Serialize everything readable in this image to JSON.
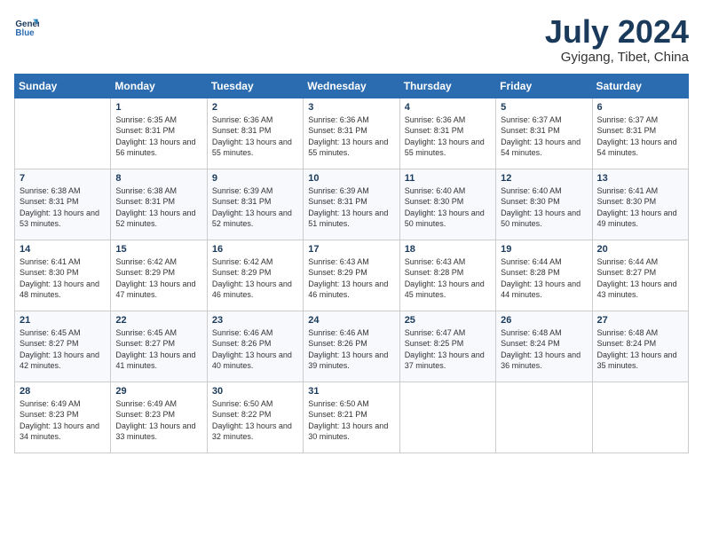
{
  "header": {
    "logo_line1": "General",
    "logo_line2": "Blue",
    "month_title": "July 2024",
    "location": "Gyigang, Tibet, China"
  },
  "weekdays": [
    "Sunday",
    "Monday",
    "Tuesday",
    "Wednesday",
    "Thursday",
    "Friday",
    "Saturday"
  ],
  "weeks": [
    [
      {
        "day": "",
        "sunrise": "",
        "sunset": "",
        "daylight": ""
      },
      {
        "day": "1",
        "sunrise": "6:35 AM",
        "sunset": "8:31 PM",
        "daylight": "13 hours and 56 minutes."
      },
      {
        "day": "2",
        "sunrise": "6:36 AM",
        "sunset": "8:31 PM",
        "daylight": "13 hours and 55 minutes."
      },
      {
        "day": "3",
        "sunrise": "6:36 AM",
        "sunset": "8:31 PM",
        "daylight": "13 hours and 55 minutes."
      },
      {
        "day": "4",
        "sunrise": "6:36 AM",
        "sunset": "8:31 PM",
        "daylight": "13 hours and 55 minutes."
      },
      {
        "day": "5",
        "sunrise": "6:37 AM",
        "sunset": "8:31 PM",
        "daylight": "13 hours and 54 minutes."
      },
      {
        "day": "6",
        "sunrise": "6:37 AM",
        "sunset": "8:31 PM",
        "daylight": "13 hours and 54 minutes."
      }
    ],
    [
      {
        "day": "7",
        "sunrise": "6:38 AM",
        "sunset": "8:31 PM",
        "daylight": "13 hours and 53 minutes."
      },
      {
        "day": "8",
        "sunrise": "6:38 AM",
        "sunset": "8:31 PM",
        "daylight": "13 hours and 52 minutes."
      },
      {
        "day": "9",
        "sunrise": "6:39 AM",
        "sunset": "8:31 PM",
        "daylight": "13 hours and 52 minutes."
      },
      {
        "day": "10",
        "sunrise": "6:39 AM",
        "sunset": "8:31 PM",
        "daylight": "13 hours and 51 minutes."
      },
      {
        "day": "11",
        "sunrise": "6:40 AM",
        "sunset": "8:30 PM",
        "daylight": "13 hours and 50 minutes."
      },
      {
        "day": "12",
        "sunrise": "6:40 AM",
        "sunset": "8:30 PM",
        "daylight": "13 hours and 50 minutes."
      },
      {
        "day": "13",
        "sunrise": "6:41 AM",
        "sunset": "8:30 PM",
        "daylight": "13 hours and 49 minutes."
      }
    ],
    [
      {
        "day": "14",
        "sunrise": "6:41 AM",
        "sunset": "8:30 PM",
        "daylight": "13 hours and 48 minutes."
      },
      {
        "day": "15",
        "sunrise": "6:42 AM",
        "sunset": "8:29 PM",
        "daylight": "13 hours and 47 minutes."
      },
      {
        "day": "16",
        "sunrise": "6:42 AM",
        "sunset": "8:29 PM",
        "daylight": "13 hours and 46 minutes."
      },
      {
        "day": "17",
        "sunrise": "6:43 AM",
        "sunset": "8:29 PM",
        "daylight": "13 hours and 46 minutes."
      },
      {
        "day": "18",
        "sunrise": "6:43 AM",
        "sunset": "8:28 PM",
        "daylight": "13 hours and 45 minutes."
      },
      {
        "day": "19",
        "sunrise": "6:44 AM",
        "sunset": "8:28 PM",
        "daylight": "13 hours and 44 minutes."
      },
      {
        "day": "20",
        "sunrise": "6:44 AM",
        "sunset": "8:27 PM",
        "daylight": "13 hours and 43 minutes."
      }
    ],
    [
      {
        "day": "21",
        "sunrise": "6:45 AM",
        "sunset": "8:27 PM",
        "daylight": "13 hours and 42 minutes."
      },
      {
        "day": "22",
        "sunrise": "6:45 AM",
        "sunset": "8:27 PM",
        "daylight": "13 hours and 41 minutes."
      },
      {
        "day": "23",
        "sunrise": "6:46 AM",
        "sunset": "8:26 PM",
        "daylight": "13 hours and 40 minutes."
      },
      {
        "day": "24",
        "sunrise": "6:46 AM",
        "sunset": "8:26 PM",
        "daylight": "13 hours and 39 minutes."
      },
      {
        "day": "25",
        "sunrise": "6:47 AM",
        "sunset": "8:25 PM",
        "daylight": "13 hours and 37 minutes."
      },
      {
        "day": "26",
        "sunrise": "6:48 AM",
        "sunset": "8:24 PM",
        "daylight": "13 hours and 36 minutes."
      },
      {
        "day": "27",
        "sunrise": "6:48 AM",
        "sunset": "8:24 PM",
        "daylight": "13 hours and 35 minutes."
      }
    ],
    [
      {
        "day": "28",
        "sunrise": "6:49 AM",
        "sunset": "8:23 PM",
        "daylight": "13 hours and 34 minutes."
      },
      {
        "day": "29",
        "sunrise": "6:49 AM",
        "sunset": "8:23 PM",
        "daylight": "13 hours and 33 minutes."
      },
      {
        "day": "30",
        "sunrise": "6:50 AM",
        "sunset": "8:22 PM",
        "daylight": "13 hours and 32 minutes."
      },
      {
        "day": "31",
        "sunrise": "6:50 AM",
        "sunset": "8:21 PM",
        "daylight": "13 hours and 30 minutes."
      },
      {
        "day": "",
        "sunrise": "",
        "sunset": "",
        "daylight": ""
      },
      {
        "day": "",
        "sunrise": "",
        "sunset": "",
        "daylight": ""
      },
      {
        "day": "",
        "sunrise": "",
        "sunset": "",
        "daylight": ""
      }
    ]
  ],
  "labels": {
    "sunrise_prefix": "Sunrise: ",
    "sunset_prefix": "Sunset: ",
    "daylight_prefix": "Daylight: "
  }
}
